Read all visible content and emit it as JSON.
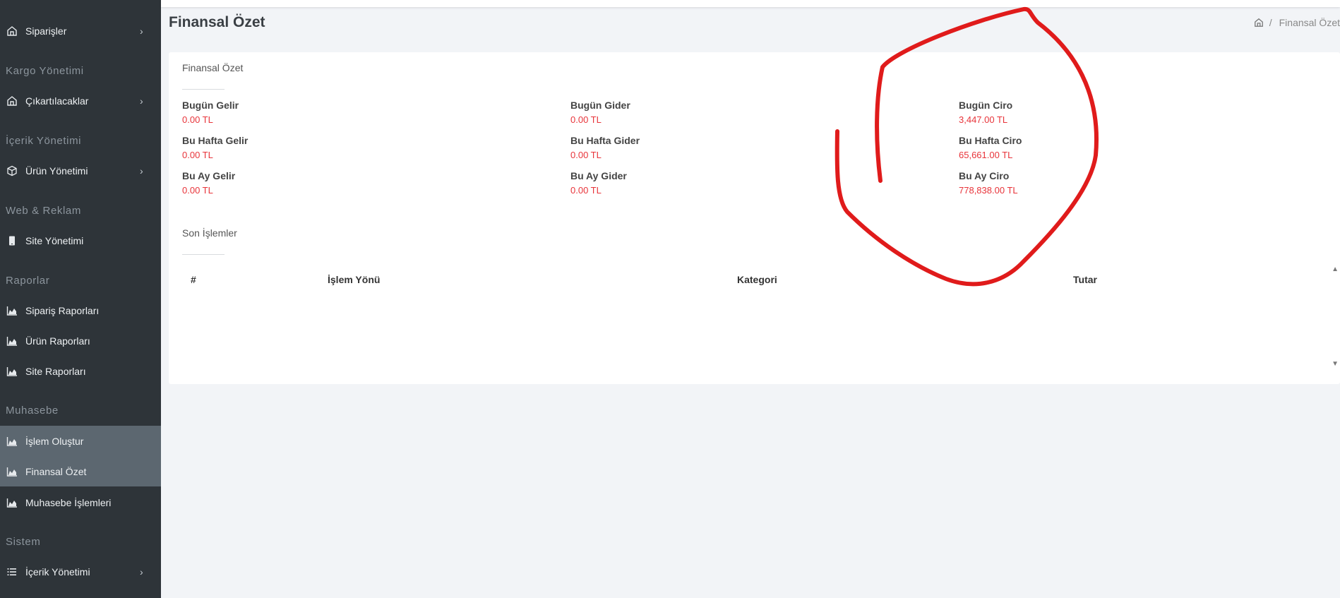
{
  "sidebar": {
    "items": [
      {
        "label": "Siparişler",
        "icon": "home-icon",
        "chevron": "›"
      },
      {
        "label": "Çıkartılacaklar",
        "icon": "home-icon",
        "chevron": "›"
      },
      {
        "label": "Ürün Yönetimi",
        "icon": "box-icon",
        "chevron": "›"
      },
      {
        "label": "Site Yönetimi",
        "icon": "mobile-icon"
      },
      {
        "label": "Sipariş Raporları",
        "icon": "area-chart-icon"
      },
      {
        "label": "Ürün Raporları",
        "icon": "area-chart-icon"
      },
      {
        "label": "Site Raporları",
        "icon": "area-chart-icon"
      },
      {
        "label": "İşlem Oluştur",
        "icon": "area-chart-icon"
      },
      {
        "label": "Finansal Özet",
        "icon": "area-chart-icon"
      },
      {
        "label": "Muhasebe İşlemleri",
        "icon": "area-chart-icon"
      },
      {
        "label": "İçerik Yönetimi",
        "icon": "list-icon",
        "chevron": "›"
      }
    ],
    "sections": [
      "Kargo Yönetimi",
      "İçerik Yönetimi",
      "Web & Reklam",
      "Raporlar",
      "Muhasebe",
      "Sistem"
    ]
  },
  "header": {
    "title": "Finansal Özet",
    "breadcrumb_sep": "/",
    "breadcrumb_current": "Finansal Özet"
  },
  "summary": {
    "title": "Finansal Özet",
    "metrics": [
      {
        "label": "Bugün Gelir",
        "value": "0.00 TL"
      },
      {
        "label": "Bu Hafta Gelir",
        "value": "0.00 TL"
      },
      {
        "label": "Bu Ay Gelir",
        "value": "0.00 TL"
      },
      {
        "label": "Bugün Gider",
        "value": "0.00 TL"
      },
      {
        "label": "Bu Hafta Gider",
        "value": "0.00 TL"
      },
      {
        "label": "Bu Ay Gider",
        "value": "0.00 TL"
      },
      {
        "label": "Bugün Ciro",
        "value": "3,447.00 TL"
      },
      {
        "label": "Bu Hafta Ciro",
        "value": "65,661.00 TL"
      },
      {
        "label": "Bu Ay Ciro",
        "value": "778,838.00 TL"
      }
    ]
  },
  "recent": {
    "title": "Son İşlemler",
    "columns": [
      "#",
      "İşlem Yönü",
      "Kategori",
      "Tutar"
    ]
  },
  "colors": {
    "sidebar_bg": "#2e3439",
    "active_bg": "#5c6770",
    "value_red": "#e8343a",
    "annotation_red": "#e01b1b"
  }
}
